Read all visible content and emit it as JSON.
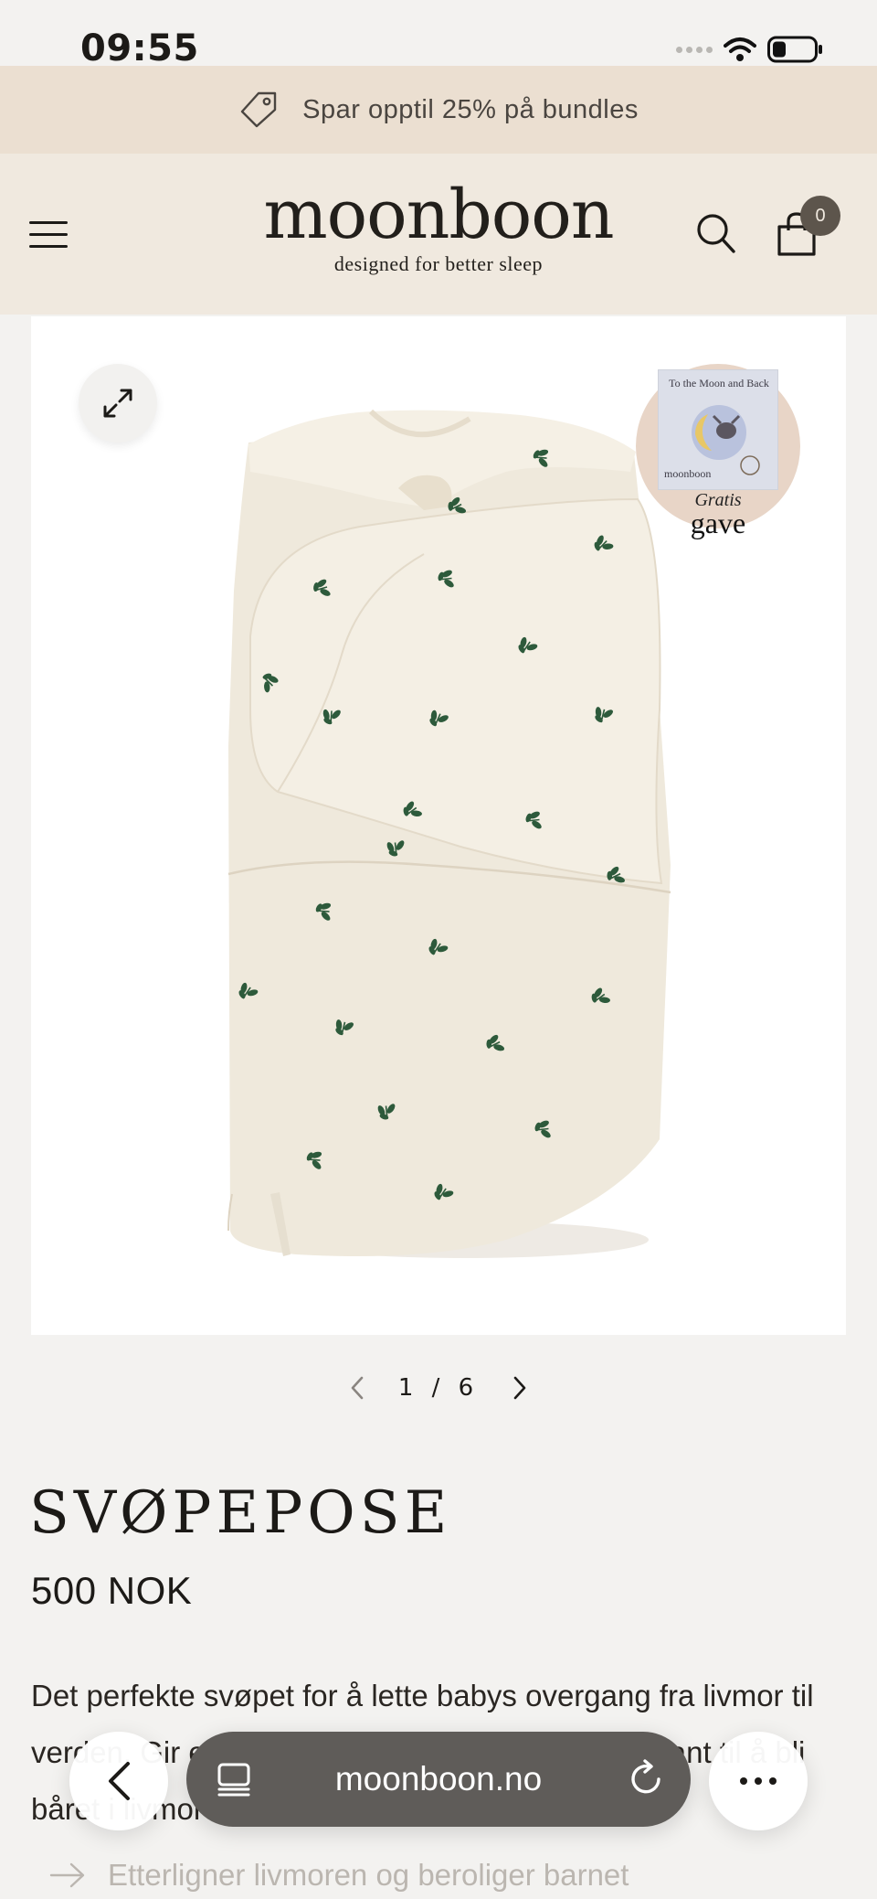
{
  "status_bar": {
    "time": "09:55"
  },
  "promo": {
    "text": "Spar opptil 25% på bundles"
  },
  "header": {
    "brand": "moonboon",
    "tagline": "designed for better sleep",
    "cart_count": "0"
  },
  "gift": {
    "book_title": "To the Moon and Back",
    "book_brand": "moonboon",
    "label_line1": "Gratis",
    "label_line2": "gave"
  },
  "gallery": {
    "pager": "1 / 6"
  },
  "product": {
    "title": "SVØPEPOSE",
    "price": "500 NOK",
    "description": "Det perfekte svøpet for å lette babys overgang fra livmor til verden. Gir en trygg følelse for babyen som er vant til å bli båret i livmorens trange rom.",
    "feature": "Etterligner livmoren og beroliger barnet"
  },
  "browser": {
    "url": "moonboon.no"
  },
  "colors": {
    "page_bg": "#f3f2f0",
    "promo_bg": "#ebdfd1",
    "header_bg": "#f0e9df",
    "product_fabric": "#efe9dc",
    "leaf": "#2d5a3b",
    "url_pill": "#5f5c59"
  }
}
